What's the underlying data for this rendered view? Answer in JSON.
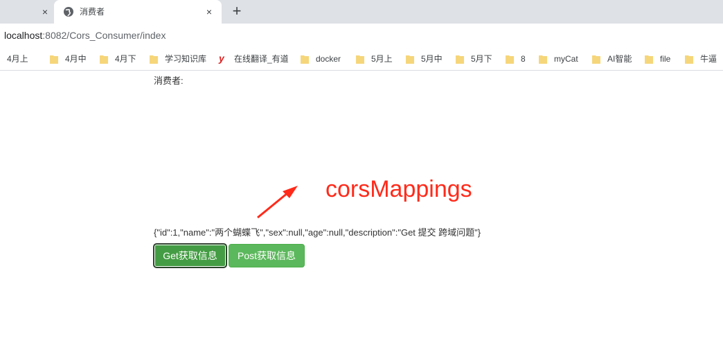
{
  "browser": {
    "prev_tab_close": "×",
    "active_tab": {
      "title": "消费者",
      "close": "×"
    },
    "new_tab": "+",
    "url": {
      "host": "localhost",
      "rest": ":8082/Cors_Consumer/index"
    },
    "bookmarks": [
      {
        "label": "4月上",
        "icon": "folder-icon"
      },
      {
        "label": "4月中",
        "icon": "folder-icon"
      },
      {
        "label": "4月下",
        "icon": "folder-icon"
      },
      {
        "label": "学习知识库",
        "icon": "folder-icon"
      },
      {
        "label": "在线翻译_有道",
        "icon": "youdao-icon"
      },
      {
        "label": "docker",
        "icon": "folder-icon"
      },
      {
        "label": "5月上",
        "icon": "folder-icon"
      },
      {
        "label": "5月中",
        "icon": "folder-icon"
      },
      {
        "label": "5月下",
        "icon": "folder-icon"
      },
      {
        "label": "8",
        "icon": "folder-icon"
      },
      {
        "label": "myCat",
        "icon": "folder-icon"
      },
      {
        "label": "AI智能",
        "icon": "folder-icon"
      },
      {
        "label": "file",
        "icon": "folder-icon"
      },
      {
        "label": "牛逼",
        "icon": "folder-icon"
      }
    ]
  },
  "page": {
    "heading": "消费者:",
    "annotation": "corsMappings",
    "result": "{\"id\":1,\"name\":\"两个蝴蝶飞\",\"sex\":null,\"age\":null,\"description\":\"Get 提交 跨域问题\"}",
    "get_button": "Get获取信息",
    "post_button": "Post获取信息"
  },
  "colors": {
    "annotation": "#ff2a1a",
    "button_green": "#5cb85c",
    "button_green_active": "#449d44",
    "tabstrip": "#dee1e6"
  }
}
